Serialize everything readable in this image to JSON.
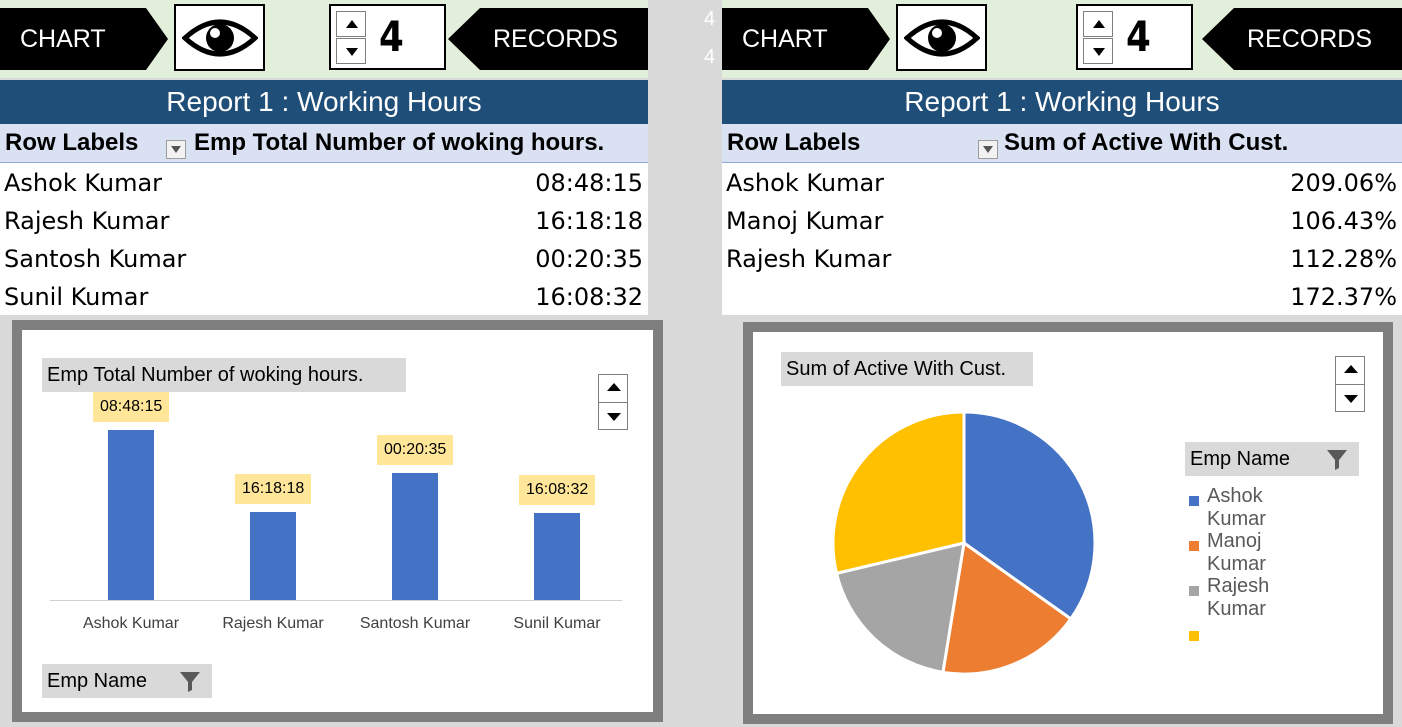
{
  "stray_text": [
    "4",
    "4"
  ],
  "left": {
    "chart_label": "CHART",
    "spinner_value": "4",
    "records_label": "RECORDS",
    "title": "Report 1 : Working Hours",
    "table": {
      "headers": [
        "Row Labels",
        "Emp Total Number of woking hours."
      ],
      "rows": [
        {
          "name": "Ashok Kumar",
          "value": "08:48:15"
        },
        {
          "name": "Rajesh Kumar",
          "value": "16:18:18"
        },
        {
          "name": "Santosh Kumar",
          "value": "00:20:35"
        },
        {
          "name": "Sunil Kumar",
          "value": "16:08:32"
        }
      ]
    },
    "chart_title_button": "Emp Total Number of woking hours.",
    "field_button": "Emp Name"
  },
  "right": {
    "chart_label": "CHART",
    "spinner_value": "4",
    "records_label": "RECORDS",
    "title": "Report 1 : Working Hours",
    "table": {
      "headers": [
        "Row Labels",
        "Sum of Active With Cust."
      ],
      "rows": [
        {
          "name": "Ashok Kumar",
          "value": "209.06%"
        },
        {
          "name": "Manoj Kumar",
          "value": "106.43%"
        },
        {
          "name": "Rajesh Kumar",
          "value": "112.28%"
        },
        {
          "name": "",
          "value": "172.37%"
        }
      ]
    },
    "chart_title_button": "Sum of Active With Cust.",
    "legend_title": "Emp Name"
  },
  "chart_data": [
    {
      "type": "bar",
      "categories": [
        "Ashok Kumar",
        "Rajesh Kumar",
        "Santosh Kumar",
        "Sunil Kumar"
      ],
      "values": [
        1.0,
        0.52,
        0.75,
        0.51
      ],
      "data_labels": [
        "08:48:15",
        "16:18:18",
        "00:20:35",
        "16:08:32"
      ],
      "title": "Emp Total Number of woking hours.",
      "color": "#4472c4",
      "label_color": "#ffe699",
      "grid": false
    },
    {
      "type": "pie",
      "categories": [
        "Ashok Kumar",
        "Manoj Kumar",
        "Rajesh Kumar",
        ""
      ],
      "values": [
        209.06,
        106.43,
        112.28,
        172.37
      ],
      "colors": [
        "#4472c4",
        "#ed7d31",
        "#a5a5a5",
        "#ffc000"
      ],
      "title": "Sum of Active With Cust.",
      "legend_title": "Emp Name",
      "legend_placement": "right"
    }
  ]
}
